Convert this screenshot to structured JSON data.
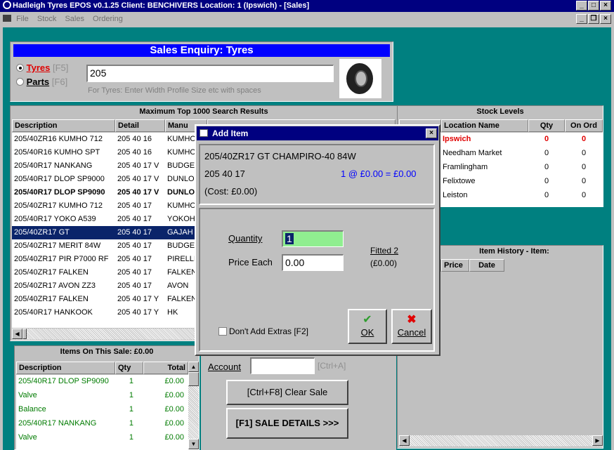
{
  "window": {
    "title": "Hadleigh Tyres EPOS v0.1.25   Client: BENCHIVERS   Location: 1 (Ipswich)    - [Sales]"
  },
  "menu": [
    "File",
    "Stock",
    "Sales",
    "Ordering"
  ],
  "enquiry": {
    "title": "Sales Enquiry: Tyres",
    "tyres_label": "Tyres",
    "tyres_key": "[F5]",
    "parts_label": "Parts",
    "parts_key": "[F6]",
    "search_value": "205",
    "hint": "For Tyres: Enter Width Profile Size etc with spaces"
  },
  "results": {
    "title": "Maximum Top 1000 Search Results",
    "columns": [
      "Description",
      "Detail",
      "Manu"
    ],
    "rows": [
      {
        "description": "205/40ZR16 KUMHO 712",
        "detail": "205 40 16",
        "manu": "KUMHO",
        "style": ""
      },
      {
        "description": "205/40R16 KUMHO SPT",
        "detail": "205 40 16",
        "manu": "KUMHO",
        "style": ""
      },
      {
        "description": "205/40R17 NANKANG",
        "detail": "205 40 17 V",
        "manu": "BUDGET",
        "style": ""
      },
      {
        "description": "205/40R17 DLOP SP9000",
        "detail": "205 40 17 V",
        "manu": "DUNLOP",
        "style": ""
      },
      {
        "description": "205/40R17 DLOP SP9090",
        "detail": "205 40 17 V",
        "manu": "DUNLOP",
        "style": "bold"
      },
      {
        "description": "205/40ZR17 KUMHO 712",
        "detail": "205 40 17",
        "manu": "KUMHO",
        "style": ""
      },
      {
        "description": "205/40R17 YOKO A539",
        "detail": "205 40 17",
        "manu": "YOKOHAMA",
        "style": ""
      },
      {
        "description": "205/40ZR17 GT",
        "detail": "205 40 17",
        "manu": "GAJAH",
        "style": "sel"
      },
      {
        "description": "205/40ZR17 MERIT 84W",
        "detail": "205 40 17",
        "manu": "BUDGET",
        "style": ""
      },
      {
        "description": "205/40ZR17 PIR P7000 RF",
        "detail": "205 40 17",
        "manu": "PIRELLI",
        "style": ""
      },
      {
        "description": "205/40ZR17 FALKEN",
        "detail": "205 40 17",
        "manu": "FALKEN",
        "style": ""
      },
      {
        "description": "205/40ZR17 AVON ZZ3",
        "detail": "205 40 17",
        "manu": "AVON",
        "style": ""
      },
      {
        "description": "205/40ZR17 FALKEN",
        "detail": "205 40 17 Y",
        "manu": "FALKEN",
        "style": ""
      },
      {
        "description": "205/40R17 HANKOOK",
        "detail": "205 40 17 Y",
        "manu": "HK",
        "style": ""
      }
    ]
  },
  "sale_items": {
    "title": "Items On This Sale: £0.00",
    "columns": [
      "Description",
      "Qty",
      "Total"
    ],
    "rows": [
      {
        "description": "205/40R17 DLOP SP9090",
        "qty": "1",
        "total": "£0.00"
      },
      {
        "description": "Valve",
        "qty": "1",
        "total": "£0.00"
      },
      {
        "description": "Balance",
        "qty": "1",
        "total": "£0.00"
      },
      {
        "description": "205/40R17 NANKANG",
        "qty": "1",
        "total": "£0.00"
      },
      {
        "description": "Valve",
        "qty": "1",
        "total": "£0.00"
      }
    ]
  },
  "account": {
    "label": "Account",
    "hint": "[Ctrl+A]",
    "value": ""
  },
  "buttons": {
    "clear_sale": "[Ctrl+F8] Clear Sale",
    "sale_details": "[F1] SALE DETAILS >>>"
  },
  "stock": {
    "title": "Stock Levels",
    "columns": [
      "Location Name",
      "Qty",
      "On Ord"
    ],
    "rows": [
      {
        "location": "Ipswich",
        "qty": "0",
        "on_ord": "0",
        "style": "red"
      },
      {
        "location": "Needham Market",
        "qty": "0",
        "on_ord": "0",
        "style": ""
      },
      {
        "location": "Framlingham",
        "qty": "0",
        "on_ord": "0",
        "style": ""
      },
      {
        "location": "Felixtowe",
        "qty": "0",
        "on_ord": "0",
        "style": ""
      },
      {
        "location": "Leiston",
        "qty": "0",
        "on_ord": "0",
        "style": ""
      }
    ]
  },
  "history": {
    "title": "Item History - Item:",
    "columns": [
      "Price",
      "Date"
    ]
  },
  "dialog": {
    "title": "Add Item",
    "item_name": "205/40ZR17 GT CHAMPIRO-40 84W",
    "item_size": "205 40 17",
    "line_summary": "1 @ £0.00 = £0.00",
    "cost": "(Cost: £0.00)",
    "quantity_label": "Quantity",
    "quantity_value": "1",
    "price_label": "Price Each",
    "price_value": "0.00",
    "fitted_label": "Fitted 2",
    "fitted_value": "(£0.00)",
    "extras_label": "Don't Add Extras [F2]",
    "ok_label": "OK",
    "cancel_label": "Cancel"
  }
}
